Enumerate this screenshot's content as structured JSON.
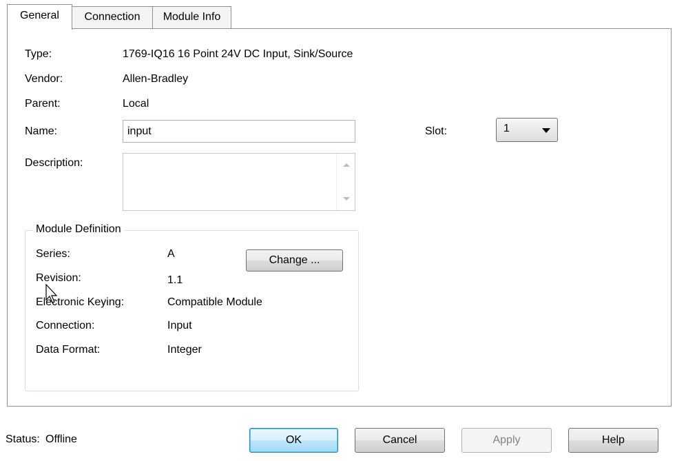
{
  "tabs": [
    {
      "label": "General",
      "active": true
    },
    {
      "label": "Connection",
      "active": false
    },
    {
      "label": "Module Info",
      "active": false
    }
  ],
  "general": {
    "type_label": "Type:",
    "type_value": "1769-IQ16 16 Point 24V DC Input, Sink/Source",
    "vendor_label": "Vendor:",
    "vendor_value": "Allen-Bradley",
    "parent_label": "Parent:",
    "parent_value": "Local",
    "name_label": "Name:",
    "name_value": "input",
    "description_label": "Description:",
    "description_value": "",
    "slot_label": "Slot:",
    "slot_value": "1"
  },
  "module_definition": {
    "title": "Module Definition",
    "series_label": "Series:",
    "series_value": "A",
    "revision_label": "Revision:",
    "revision_value": "1.1",
    "keying_label": "Electronic Keying:",
    "keying_value": "Compatible Module",
    "connection_label": "Connection:",
    "connection_value": "Input",
    "data_format_label": "Data Format:",
    "data_format_value": "Integer",
    "change_button": "Change ..."
  },
  "footer": {
    "status_label": "Status:",
    "status_value": "Offline",
    "ok_button": "OK",
    "cancel_button": "Cancel",
    "apply_button": "Apply",
    "help_button": "Help"
  },
  "icons": {
    "cursor": "mouse-pointer-icon",
    "scroll_up": "scroll-up-arrow-icon",
    "scroll_down": "scroll-down-arrow-icon",
    "dropdown": "chevron-down-icon"
  }
}
